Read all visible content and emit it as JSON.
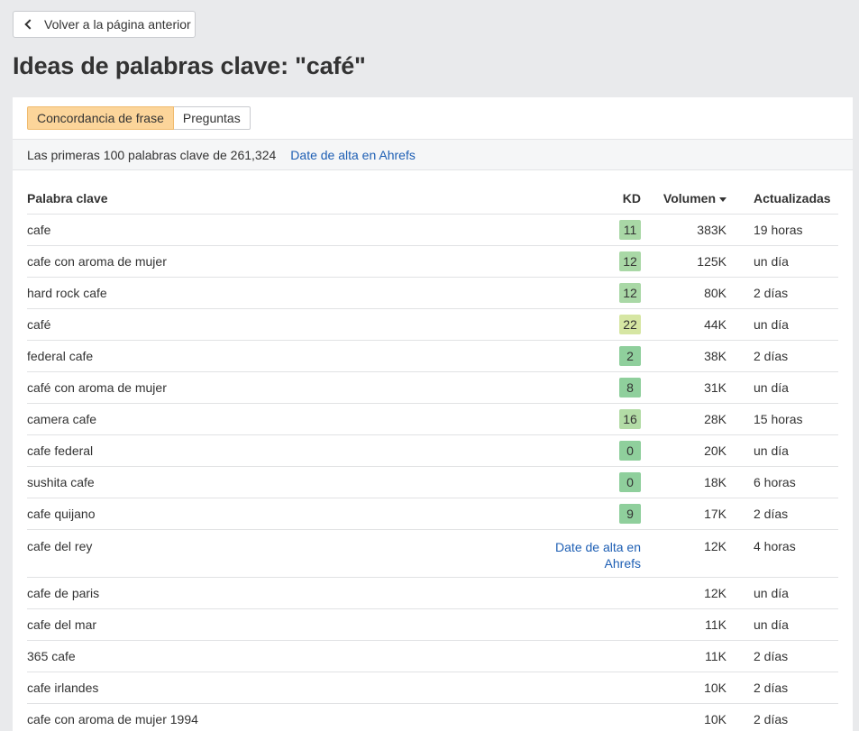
{
  "back_button": {
    "label": "Volver a la página anterior"
  },
  "page_title": "Ideas de palabras clave: \"café\"",
  "tabs": [
    {
      "label": "Concordancia de frase",
      "active": true
    },
    {
      "label": "Preguntas",
      "active": false
    }
  ],
  "info": {
    "text": "Las primeras 100 palabras clave de 261,324",
    "link": "Date de alta en Ahrefs"
  },
  "table": {
    "headers": {
      "keyword": "Palabra clave",
      "kd": "KD",
      "volume": "Volumen",
      "updated": "Actualizadas"
    },
    "rows": [
      {
        "keyword": "cafe",
        "kd": "11",
        "kd_color": "#a9d8a6",
        "volume": "383K",
        "updated": "19 horas"
      },
      {
        "keyword": "cafe con aroma de mujer",
        "kd": "12",
        "kd_color": "#a9d8a6",
        "volume": "125K",
        "updated": "un día"
      },
      {
        "keyword": "hard rock cafe",
        "kd": "12",
        "kd_color": "#a9d8a6",
        "volume": "80K",
        "updated": "2 días"
      },
      {
        "keyword": "café",
        "kd": "22",
        "kd_color": "#d6e6a3",
        "volume": "44K",
        "updated": "un día"
      },
      {
        "keyword": "federal cafe",
        "kd": "2",
        "kd_color": "#8fcf9c",
        "volume": "38K",
        "updated": "2 días"
      },
      {
        "keyword": "café con aroma de mujer",
        "kd": "8",
        "kd_color": "#8fcf9c",
        "volume": "31K",
        "updated": "un día"
      },
      {
        "keyword": "camera cafe",
        "kd": "16",
        "kd_color": "#b3dca6",
        "volume": "28K",
        "updated": "15 horas"
      },
      {
        "keyword": "cafe federal",
        "kd": "0",
        "kd_color": "#8fcf9c",
        "volume": "20K",
        "updated": "un día"
      },
      {
        "keyword": "sushita cafe",
        "kd": "0",
        "kd_color": "#8fcf9c",
        "volume": "18K",
        "updated": "6 horas"
      },
      {
        "keyword": "cafe quijano",
        "kd": "9",
        "kd_color": "#8fcf9c",
        "volume": "17K",
        "updated": "2 días"
      },
      {
        "keyword": "cafe del rey",
        "kd_link": "Date de alta en Ahrefs",
        "volume": "12K",
        "updated": "4 horas"
      },
      {
        "keyword": "cafe de paris",
        "kd": "",
        "volume": "12K",
        "updated": "un día"
      },
      {
        "keyword": "cafe del mar",
        "kd": "",
        "volume": "11K",
        "updated": "un día"
      },
      {
        "keyword": "365 cafe",
        "kd": "",
        "volume": "11K",
        "updated": "2 días"
      },
      {
        "keyword": "cafe irlandes",
        "kd": "",
        "volume": "10K",
        "updated": "2 días"
      },
      {
        "keyword": "cafe con aroma de mujer 1994",
        "kd": "",
        "volume": "10K",
        "updated": "2 días"
      }
    ]
  }
}
